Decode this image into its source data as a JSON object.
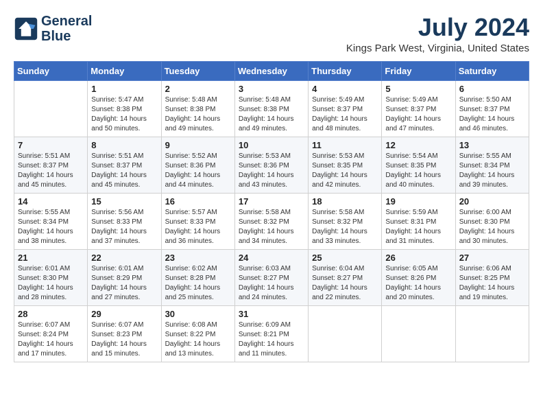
{
  "logo": {
    "line1": "General",
    "line2": "Blue"
  },
  "title": "July 2024",
  "location": "Kings Park West, Virginia, United States",
  "days_of_week": [
    "Sunday",
    "Monday",
    "Tuesday",
    "Wednesday",
    "Thursday",
    "Friday",
    "Saturday"
  ],
  "weeks": [
    [
      {
        "day": "",
        "sunrise": "",
        "sunset": "",
        "daylight": ""
      },
      {
        "day": "1",
        "sunrise": "5:47 AM",
        "sunset": "8:38 PM",
        "daylight": "14 hours and 50 minutes."
      },
      {
        "day": "2",
        "sunrise": "5:48 AM",
        "sunset": "8:38 PM",
        "daylight": "14 hours and 49 minutes."
      },
      {
        "day": "3",
        "sunrise": "5:48 AM",
        "sunset": "8:38 PM",
        "daylight": "14 hours and 49 minutes."
      },
      {
        "day": "4",
        "sunrise": "5:49 AM",
        "sunset": "8:37 PM",
        "daylight": "14 hours and 48 minutes."
      },
      {
        "day": "5",
        "sunrise": "5:49 AM",
        "sunset": "8:37 PM",
        "daylight": "14 hours and 47 minutes."
      },
      {
        "day": "6",
        "sunrise": "5:50 AM",
        "sunset": "8:37 PM",
        "daylight": "14 hours and 46 minutes."
      }
    ],
    [
      {
        "day": "7",
        "sunrise": "5:51 AM",
        "sunset": "8:37 PM",
        "daylight": "14 hours and 45 minutes."
      },
      {
        "day": "8",
        "sunrise": "5:51 AM",
        "sunset": "8:37 PM",
        "daylight": "14 hours and 45 minutes."
      },
      {
        "day": "9",
        "sunrise": "5:52 AM",
        "sunset": "8:36 PM",
        "daylight": "14 hours and 44 minutes."
      },
      {
        "day": "10",
        "sunrise": "5:53 AM",
        "sunset": "8:36 PM",
        "daylight": "14 hours and 43 minutes."
      },
      {
        "day": "11",
        "sunrise": "5:53 AM",
        "sunset": "8:35 PM",
        "daylight": "14 hours and 42 minutes."
      },
      {
        "day": "12",
        "sunrise": "5:54 AM",
        "sunset": "8:35 PM",
        "daylight": "14 hours and 40 minutes."
      },
      {
        "day": "13",
        "sunrise": "5:55 AM",
        "sunset": "8:34 PM",
        "daylight": "14 hours and 39 minutes."
      }
    ],
    [
      {
        "day": "14",
        "sunrise": "5:55 AM",
        "sunset": "8:34 PM",
        "daylight": "14 hours and 38 minutes."
      },
      {
        "day": "15",
        "sunrise": "5:56 AM",
        "sunset": "8:33 PM",
        "daylight": "14 hours and 37 minutes."
      },
      {
        "day": "16",
        "sunrise": "5:57 AM",
        "sunset": "8:33 PM",
        "daylight": "14 hours and 36 minutes."
      },
      {
        "day": "17",
        "sunrise": "5:58 AM",
        "sunset": "8:32 PM",
        "daylight": "14 hours and 34 minutes."
      },
      {
        "day": "18",
        "sunrise": "5:58 AM",
        "sunset": "8:32 PM",
        "daylight": "14 hours and 33 minutes."
      },
      {
        "day": "19",
        "sunrise": "5:59 AM",
        "sunset": "8:31 PM",
        "daylight": "14 hours and 31 minutes."
      },
      {
        "day": "20",
        "sunrise": "6:00 AM",
        "sunset": "8:30 PM",
        "daylight": "14 hours and 30 minutes."
      }
    ],
    [
      {
        "day": "21",
        "sunrise": "6:01 AM",
        "sunset": "8:30 PM",
        "daylight": "14 hours and 28 minutes."
      },
      {
        "day": "22",
        "sunrise": "6:01 AM",
        "sunset": "8:29 PM",
        "daylight": "14 hours and 27 minutes."
      },
      {
        "day": "23",
        "sunrise": "6:02 AM",
        "sunset": "8:28 PM",
        "daylight": "14 hours and 25 minutes."
      },
      {
        "day": "24",
        "sunrise": "6:03 AM",
        "sunset": "8:27 PM",
        "daylight": "14 hours and 24 minutes."
      },
      {
        "day": "25",
        "sunrise": "6:04 AM",
        "sunset": "8:27 PM",
        "daylight": "14 hours and 22 minutes."
      },
      {
        "day": "26",
        "sunrise": "6:05 AM",
        "sunset": "8:26 PM",
        "daylight": "14 hours and 20 minutes."
      },
      {
        "day": "27",
        "sunrise": "6:06 AM",
        "sunset": "8:25 PM",
        "daylight": "14 hours and 19 minutes."
      }
    ],
    [
      {
        "day": "28",
        "sunrise": "6:07 AM",
        "sunset": "8:24 PM",
        "daylight": "14 hours and 17 minutes."
      },
      {
        "day": "29",
        "sunrise": "6:07 AM",
        "sunset": "8:23 PM",
        "daylight": "14 hours and 15 minutes."
      },
      {
        "day": "30",
        "sunrise": "6:08 AM",
        "sunset": "8:22 PM",
        "daylight": "14 hours and 13 minutes."
      },
      {
        "day": "31",
        "sunrise": "6:09 AM",
        "sunset": "8:21 PM",
        "daylight": "14 hours and 11 minutes."
      },
      {
        "day": "",
        "sunrise": "",
        "sunset": "",
        "daylight": ""
      },
      {
        "day": "",
        "sunrise": "",
        "sunset": "",
        "daylight": ""
      },
      {
        "day": "",
        "sunrise": "",
        "sunset": "",
        "daylight": ""
      }
    ]
  ]
}
